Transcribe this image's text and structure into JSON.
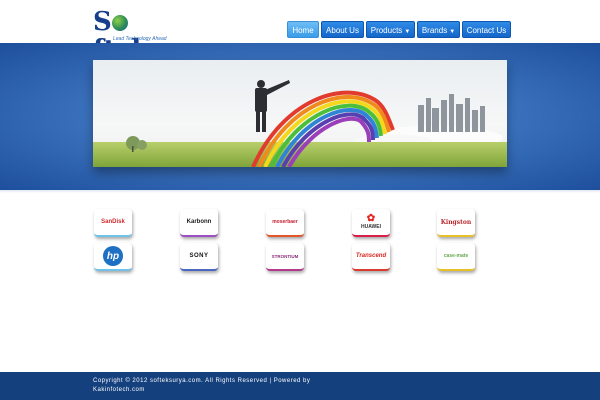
{
  "logo": {
    "text_before": "S",
    "text_after": "ftek",
    "tagline": "Lead Technology Ahead"
  },
  "nav": [
    {
      "label": "Home",
      "active": true,
      "dropdown": false
    },
    {
      "label": "About Us",
      "active": false,
      "dropdown": false
    },
    {
      "label": "Products",
      "active": false,
      "dropdown": true
    },
    {
      "label": "Brands",
      "active": false,
      "dropdown": true
    },
    {
      "label": "Contact Us",
      "active": false,
      "dropdown": false
    }
  ],
  "brands": [
    {
      "name": "SanDisk",
      "color": "#d12b2b"
    },
    {
      "name": "Karbonn",
      "color": "#222222"
    },
    {
      "name": "moserbaer",
      "color": "#c41f2f"
    },
    {
      "name": "HUAWEI",
      "color": "#e1241c"
    },
    {
      "name": "Kingston",
      "color": "#b8282d"
    },
    {
      "name": "hp",
      "color": "#1f6fc5"
    },
    {
      "name": "SONY",
      "color": "#111111"
    },
    {
      "name": "STRONTIUM",
      "color": "#8b2c7c"
    },
    {
      "name": "Transcend",
      "color": "#d8261d"
    },
    {
      "name": "case-mate",
      "color": "#6aa84f"
    }
  ],
  "footer": {
    "text": "Copyright © 2012 softeksurya.com. All Rights Reserved | Powered by Kakinfotech.com"
  },
  "colors": {
    "header_bg": "#ffffff",
    "hero_blue": "#1d4f9c",
    "nav_blue": "#1466c9",
    "footer_bg": "#14407d"
  }
}
